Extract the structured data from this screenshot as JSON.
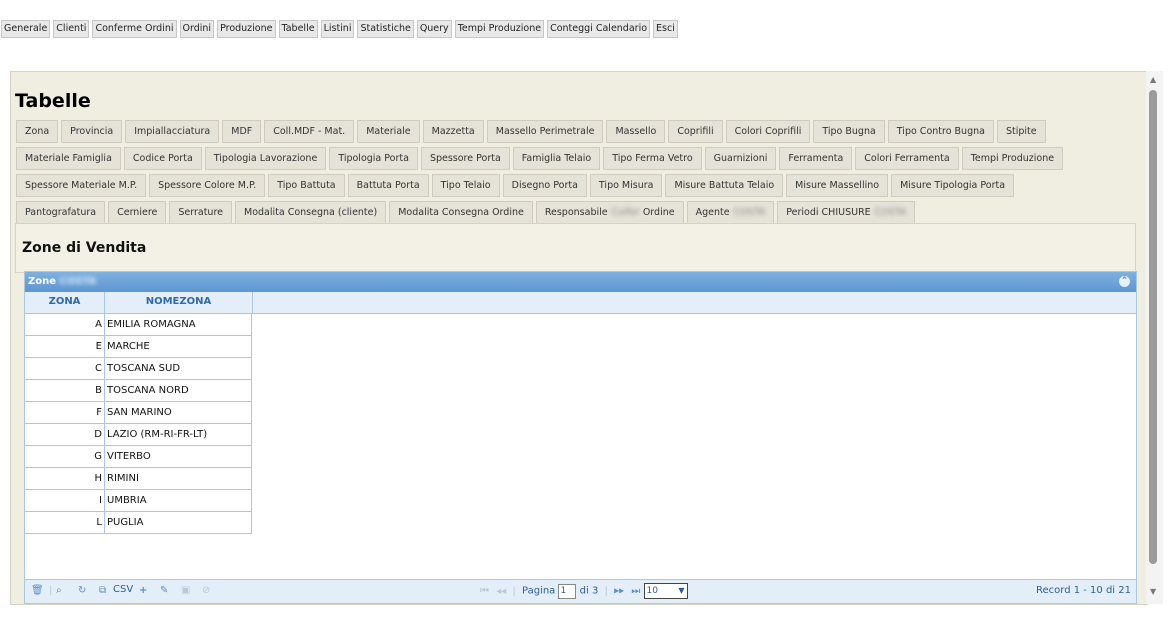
{
  "top_menu": [
    "Generale",
    "Clienti",
    "Conferme Ordini",
    "Ordini",
    "Produzione",
    "Tabelle",
    "Listini",
    "Statistiche",
    "Query",
    "Tempi Produzione",
    "Conteggi Calendario",
    "Esci"
  ],
  "page_title": "Tabelle",
  "table_tabs": [
    [
      {
        "label": "Zona"
      },
      {
        "label": "Provincia"
      },
      {
        "label": "Impiallacciatura"
      },
      {
        "label": "MDF"
      },
      {
        "label": "Coll.MDF - Mat."
      },
      {
        "label": "Materiale"
      },
      {
        "label": "Mazzetta"
      },
      {
        "label": "Massello Perimetrale"
      },
      {
        "label": "Massello"
      },
      {
        "label": "Coprifili"
      },
      {
        "label": "Colori Coprifili"
      },
      {
        "label": "Tipo Bugna"
      },
      {
        "label": "Tipo Contro Bugna"
      },
      {
        "label": "Stipite"
      }
    ],
    [
      {
        "label": "Materiale Famiglia"
      },
      {
        "label": "Codice Porta"
      },
      {
        "label": "Tipologia Lavorazione"
      },
      {
        "label": "Tipologia Porta"
      },
      {
        "label": "Spessore Porta"
      },
      {
        "label": "Famiglia Telaio"
      },
      {
        "label": "Tipo Ferma Vetro"
      },
      {
        "label": "Guarnizioni"
      },
      {
        "label": "Ferramenta"
      },
      {
        "label": "Colori Ferramenta"
      },
      {
        "label": "Tempi Produzione"
      }
    ],
    [
      {
        "label": "Spessore Materiale M.P."
      },
      {
        "label": "Spessore Colore M.P."
      },
      {
        "label": "Tipo Battuta"
      },
      {
        "label": "Battuta Porta"
      },
      {
        "label": "Tipo Telaio"
      },
      {
        "label": "Disegno Porta"
      },
      {
        "label": "Tipo Misura"
      },
      {
        "label": "Misure Battuta Telaio"
      },
      {
        "label": "Misure Massellino"
      },
      {
        "label": "Misure Tipologia Porta"
      }
    ],
    [
      {
        "label": "Pantografatura"
      },
      {
        "label": "Cerniere"
      },
      {
        "label": "Serrature"
      },
      {
        "label": "Modalita Consegna (cliente)"
      },
      {
        "label": "Modalita Consegna Ordine"
      },
      {
        "label": "Responsabile",
        "blur": "Colfer",
        "suffix": " Ordine"
      },
      {
        "label": "Agente",
        "blur": "COSTA"
      },
      {
        "label": "Periodi CHIUSURE",
        "blur": "COSTA"
      }
    ]
  ],
  "section_title": "Zone di Vendita",
  "grid": {
    "caption": "Zone",
    "caption_blur": "COSTA",
    "columns": [
      "ZONA",
      "NOMEZONA"
    ],
    "rows": [
      {
        "zona": "A",
        "nome": "EMILIA ROMAGNA"
      },
      {
        "zona": "E",
        "nome": "MARCHE"
      },
      {
        "zona": "C",
        "nome": "TOSCANA SUD"
      },
      {
        "zona": "B",
        "nome": "TOSCANA NORD"
      },
      {
        "zona": "F",
        "nome": "SAN MARINO"
      },
      {
        "zona": "D",
        "nome": "LAZIO (RM-RI-FR-LT)"
      },
      {
        "zona": "G",
        "nome": "VITERBO"
      },
      {
        "zona": "H",
        "nome": "RIMINI"
      },
      {
        "zona": "I",
        "nome": "UMBRIA"
      },
      {
        "zona": "L",
        "nome": "PUGLIA"
      }
    ]
  },
  "pager": {
    "csv_label": "CSV",
    "page_label": "Pagina",
    "page_value": "1",
    "of_label": "di 3",
    "page_size": "10",
    "record_info": "Record 1 - 10 di 21"
  },
  "icons": {
    "delete": "trash-icon",
    "search": "magnifier-icon",
    "refresh": "refresh-icon",
    "export": "export-icon",
    "add": "plus-icon",
    "edit": "pencil-icon",
    "save": "save-icon",
    "cancel": "cancel-icon"
  },
  "colors": {
    "grid_header": "#5d96d2",
    "grid_border": "#a8c8e4",
    "panel_bg": "#f0eee0"
  }
}
